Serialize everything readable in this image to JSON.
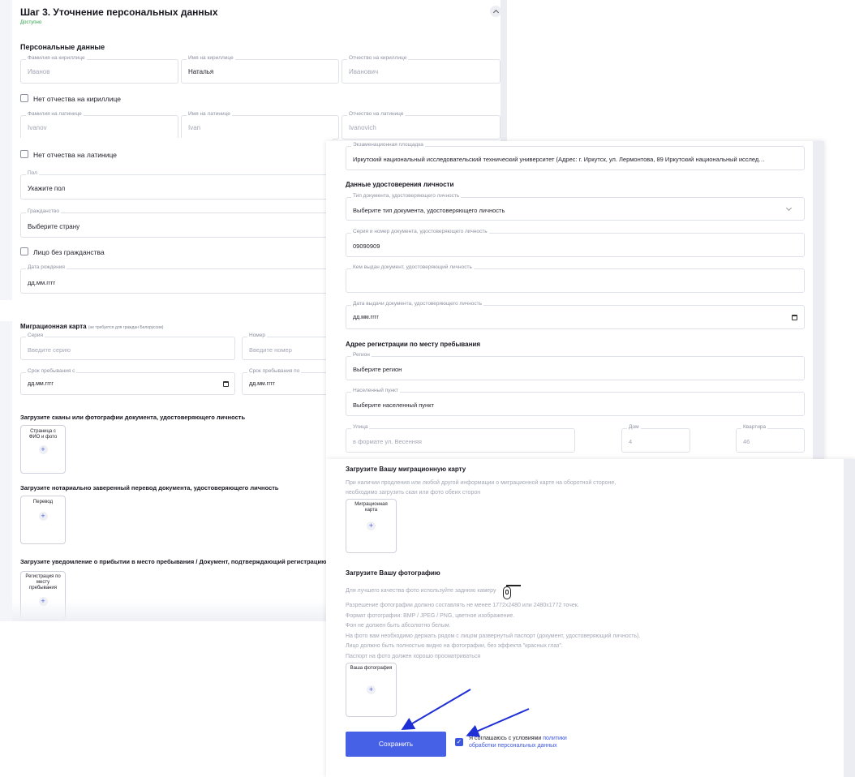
{
  "step": {
    "title": "Шаг 3. Уточнение персональных данных",
    "status": "Доступно"
  },
  "personal": {
    "heading": "Персональные данные",
    "lastname_cyr": {
      "label": "Фамилия на кириллице",
      "value": "Иванов"
    },
    "firstname_cyr": {
      "label": "Имя на кириллице",
      "value": "Наталья"
    },
    "patronymic_cyr": {
      "label": "Отчество на кириллице",
      "value": "Иванович"
    },
    "no_patronymic_cyr": "Нет отчества на кириллице",
    "lastname_lat": {
      "label": "Фамилия на латинице",
      "value": "Ivanov"
    },
    "firstname_lat": {
      "label": "Имя на латинице",
      "value": "Ivan"
    },
    "patronymic_lat": {
      "label": "Отчество на латинице",
      "value": "Ivanovich"
    },
    "no_patronymic_lat": "Нет отчества на латинице",
    "gender": {
      "label": "Пол",
      "value": "Укажите пол"
    },
    "citizenship": {
      "label": "Гражданство",
      "value": "Выберите страну"
    },
    "stateless": "Лицо без гражданства",
    "birthdate": {
      "label": "Дата рождения",
      "value": "дд.мм.гггг"
    }
  },
  "migration": {
    "heading": "Миграционная карта",
    "note": "(не требуется для граждан Белоруссии)",
    "series": {
      "label": "Серия",
      "placeholder": "Введите серию"
    },
    "number": {
      "label": "Номер",
      "placeholder": "Введите номер"
    },
    "stay_from": {
      "label": "Срок пребывания с",
      "value": "дд.мм.гггг"
    },
    "stay_to": {
      "label": "Срок пребывания по",
      "value": "дд.мм.гггг"
    }
  },
  "uploads_left": {
    "scans_heading": "Загрузите сканы или фотографии документа, удостоверяющего личность",
    "scans_tile": "Страница с ФИО и фото",
    "translation_heading": "Загрузите нотариально заверенный перевод документа, удостоверяющего личность",
    "translation_tile": "Перевод",
    "arrival_heading": "Загрузите уведомление о прибытии в место пребывания / Документ, подтверждающий регистрацию по м",
    "arrival_tile": "Регистрация по месту пребывания"
  },
  "exam": {
    "place": {
      "label": "Экзаменационная площадка",
      "value": "Иркутский национальный исследовательский технический университет (Адрес: г. Иркутск, ул. Лермонтова, 89 Иркутский национальный исслед…"
    }
  },
  "identity": {
    "heading": "Данные удостоверения личности",
    "doc_type": {
      "label": "Тип документа, удостоверяющего личность",
      "value": "Выберите тип документа, удостоверяющего личность"
    },
    "doc_number": {
      "label": "Серия и номер документа, удостоверяющего личность",
      "value": "09090909"
    },
    "issued_by": {
      "label": "Кем выдан документ, удостоверяющий личность",
      "value": ""
    },
    "issue_date": {
      "label": "Дата выдачи документа, удостоверяющего личность",
      "value": "дд.мм.гггг"
    }
  },
  "address": {
    "heading": "Адрес регистрации по месту пребывания",
    "region": {
      "label": "Регион",
      "value": "Выберите регион"
    },
    "locality": {
      "label": "Населенный пункт",
      "value": "Выберите населенный пункт"
    },
    "street": {
      "label": "Улица",
      "placeholder": "в формате ул. Весенняя"
    },
    "house": {
      "label": "Дом",
      "placeholder": "4"
    },
    "apartment": {
      "label": "Квартира",
      "placeholder": "46"
    }
  },
  "migration_upload": {
    "heading": "Загрузите Вашу миграционную карту",
    "hint1": "При наличии продления или любой другой информации о миграционной карте на оборотной стороне,",
    "hint2": "необходимо загрузить скан или фото обеих сторон",
    "tile": "Миграционная карта"
  },
  "photo_upload": {
    "heading": "Загрузите Вашу фотографию",
    "hints": [
      "Для лучшего качества фото используйте заднюю камеру",
      "Разрешение фотографии должно составлять не менее 1772х2480 или 2480х1772 точек.",
      "Формат фотографии: BMP / JPEG / PNG, цветное изображение.",
      "Фон не должен быть абсолютно белым.",
      "На фото вам необходимо держать рядом с лицом развернутый паспорт (документ, удостоверяющий личность).",
      "Лицо должно быть полностью видно на фотографии, без эффекта \"красных глаз\".",
      "Паспорт на фото должен хорошо просматриваться"
    ],
    "tile": "Ваша фотография"
  },
  "footer": {
    "save": "Сохранить",
    "consent_text": "Я соглашаюсь с условиями",
    "consent_link_1": "политики",
    "consent_link_2": "обработки персональных данных"
  },
  "colors": {
    "accent": "#4660e6",
    "status": "#2e9e4a",
    "arrow": "#1f2fd6"
  },
  "icons": [
    "chevron-up-icon",
    "calendar-icon",
    "chevron-down-icon",
    "plus-icon",
    "camera-icon",
    "checkmark-icon"
  ]
}
